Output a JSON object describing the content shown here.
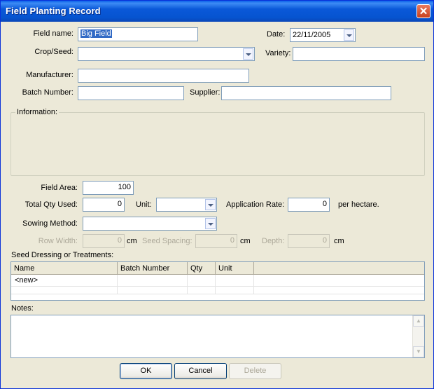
{
  "window": {
    "title": "Field Planting  Record",
    "close_glyph": "✕"
  },
  "fields": {
    "field_name": {
      "label": "Field name:",
      "value": "Big Field"
    },
    "date": {
      "label": "Date:",
      "value": "22/11/2005"
    },
    "crop_seed": {
      "label": "Crop/Seed:",
      "value": ""
    },
    "variety": {
      "label": "Variety:",
      "value": ""
    },
    "manufacturer": {
      "label": "Manufacturer:",
      "value": ""
    },
    "batch_number": {
      "label": "Batch Number:",
      "value": ""
    },
    "supplier": {
      "label": "Supplier:",
      "value": ""
    },
    "information": {
      "label": "Information:"
    },
    "field_area": {
      "label": "Field Area:",
      "value": "100"
    },
    "total_qty_used": {
      "label": "Total Qty Used:",
      "value": "0"
    },
    "unit": {
      "label": "Unit:",
      "value": ""
    },
    "application_rate": {
      "label": "Application Rate:",
      "value": "0",
      "suffix": "per hectare."
    },
    "sowing_method": {
      "label": "Sowing Method:",
      "value": ""
    },
    "row_width": {
      "label": "Row Width:",
      "value": "0",
      "unit": "cm"
    },
    "seed_spacing": {
      "label": "Seed Spacing:",
      "value": "0",
      "unit": "cm"
    },
    "depth": {
      "label": "Depth:",
      "value": "0",
      "unit": "cm"
    }
  },
  "treatments": {
    "label": "Seed Dressing or Treatments:",
    "columns": [
      "Name",
      "Batch Number",
      "Qty",
      "Unit"
    ],
    "rows": [
      [
        "<new>",
        "",
        "",
        ""
      ]
    ]
  },
  "notes": {
    "label": "Notes:",
    "value": ""
  },
  "buttons": {
    "ok": "OK",
    "cancel": "Cancel",
    "delete": "Delete"
  },
  "colors": {
    "titlebar": "#0A5FE8",
    "face": "#ECE9D8",
    "selection": "#316AC5"
  }
}
